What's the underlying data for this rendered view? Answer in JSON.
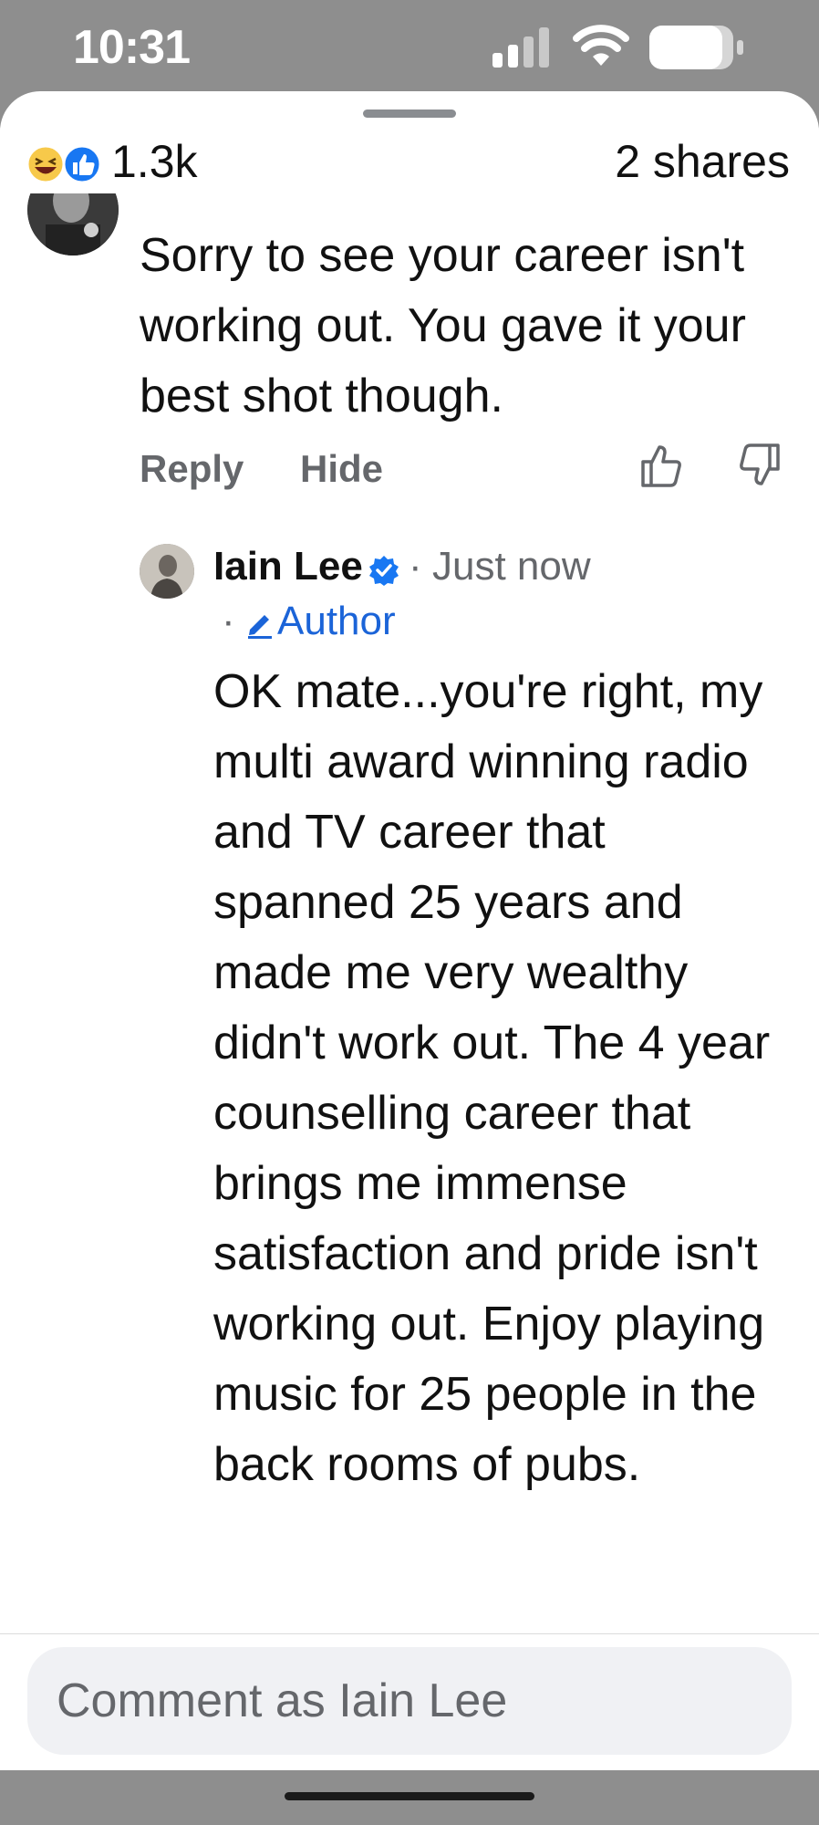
{
  "status_bar": {
    "time": "10:31"
  },
  "post_summary": {
    "reaction_icons": [
      "haha-reaction-icon",
      "like-reaction-icon"
    ],
    "reaction_count": "1.3k",
    "shares": "2 shares"
  },
  "comment": {
    "text": "Sorry to see your career isn't working out. You gave it your best shot though.",
    "actions": {
      "reply": "Reply",
      "hide": "Hide"
    }
  },
  "reply": {
    "author": "Iain Lee",
    "verified": true,
    "separator": "·",
    "time": "Just now",
    "badge": "Author",
    "text": "OK mate...you're right, my multi award winning radio and TV career that spanned 25 years and made me very wealthy didn't work out. The 4 year counselling career that brings me immense satisfaction and pride isn't working out. Enjoy playing music for 25 people in the back rooms of pubs."
  },
  "composer": {
    "placeholder": "Comment as Iain Lee",
    "value": ""
  },
  "colors": {
    "accent": "#1b64d8",
    "muted": "#65676b",
    "verified": "#1877f2"
  }
}
